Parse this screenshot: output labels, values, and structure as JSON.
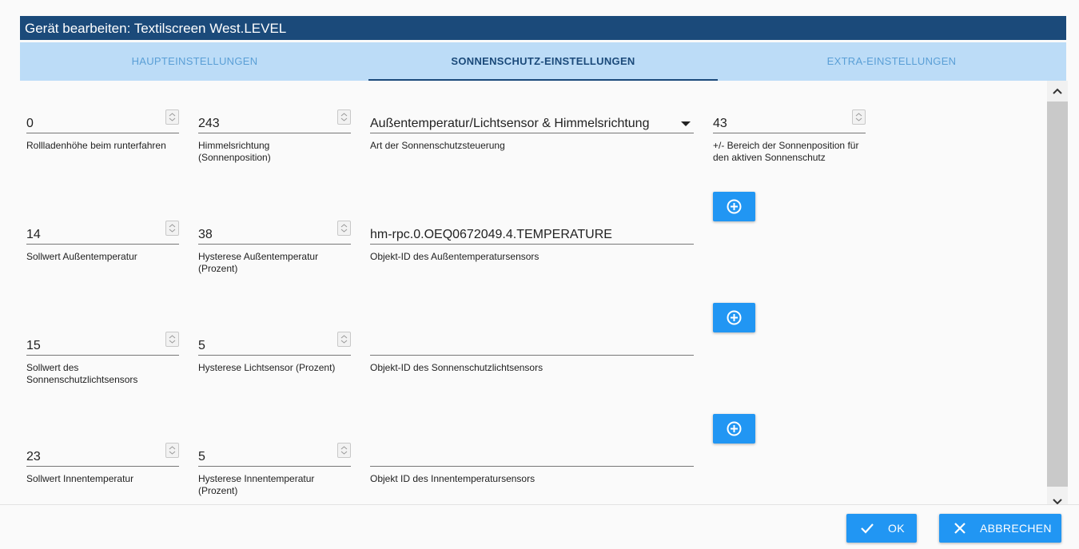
{
  "window": {
    "title": "Gerät bearbeiten: Textilscreen West.LEVEL"
  },
  "tabs": [
    {
      "label": "HAUPTEINSTELLUNGEN",
      "active": false
    },
    {
      "label": "SONNENSCHUTZ-EINSTELLUNGEN",
      "active": true
    },
    {
      "label": "EXTRA-EINSTELLUNGEN",
      "active": false
    }
  ],
  "fields": {
    "rollladenhoehe": {
      "value": "0",
      "label": "Rollladenhöhe beim runterfahren"
    },
    "himmelsrichtung": {
      "value": "243",
      "label": "Himmelsrichtung (Sonnenposition)"
    },
    "steuerung": {
      "value": "Außentemperatur/Lichtsensor & Himmelsrichtung",
      "label": "Art der Sonnenschutzsteuerung"
    },
    "bereich": {
      "value": "43",
      "label": "+/- Bereich der Sonnenposition für den aktiven Sonnenschutz"
    },
    "sollwert_aussen": {
      "value": "14",
      "label": "Sollwert Außentemperatur"
    },
    "hysterese_aussen": {
      "value": "38",
      "label": "Hysterese Außentemperatur (Prozent)"
    },
    "objekt_aussen": {
      "value": "hm-rpc.0.OEQ0672049.4.TEMPERATURE",
      "label": "Objekt-ID des Außentemperatursensors"
    },
    "sollwert_licht": {
      "value": "15",
      "label": "Sollwert des Sonnenschutzlichtsensors"
    },
    "hysterese_licht": {
      "value": "5",
      "label": "Hysterese Lichtsensor (Prozent)"
    },
    "objekt_licht": {
      "value": "",
      "label": "Objekt-ID des Sonnenschutzlichtsensors"
    },
    "sollwert_innen": {
      "value": "23",
      "label": "Sollwert Innentemperatur"
    },
    "hysterese_innen": {
      "value": "5",
      "label": "Hysterese Innentemperatur (Prozent)"
    },
    "objekt_innen": {
      "value": "",
      "label": "Objekt ID des Innentemperatursensors"
    }
  },
  "icons": {
    "add": "add-circle-icon",
    "check": "check-icon",
    "close": "close-icon"
  },
  "footer": {
    "ok_label": "OK",
    "cancel_label": "ABBRECHEN"
  },
  "colors": {
    "title_bar": "#1b4a7a",
    "tab_bar": "#bcdcf7",
    "accent": "#2196f3"
  }
}
